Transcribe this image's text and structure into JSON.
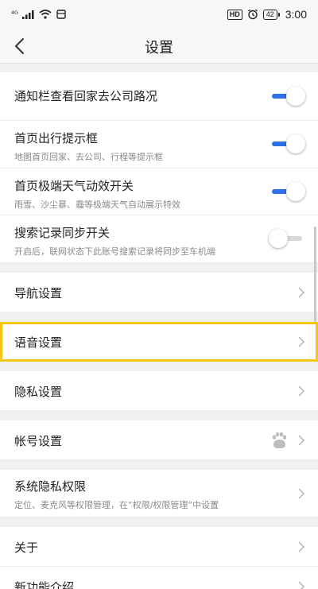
{
  "status_bar": {
    "signal_text": "⁴ᴳ",
    "hd": "HD",
    "battery": "42",
    "time": "3:00"
  },
  "header": {
    "title": "设置",
    "back_icon": "chevron-left-icon"
  },
  "settings": {
    "notif_route": {
      "label": "通知栏查看回家去公司路况",
      "toggle_state": "on"
    },
    "home_prompt": {
      "label": "首页出行提示框",
      "sub": "地图首页回家、去公司、行程等提示框",
      "toggle_state": "on"
    },
    "weather": {
      "label": "首页极端天气动效开关",
      "sub": "雨雪、沙尘暴、霾等极端天气自动展示特效",
      "toggle_state": "on"
    },
    "search_sync": {
      "label": "搜索记录同步开关",
      "sub": "开启后，联网状态下此账号搜索记录将同步至车机端",
      "toggle_state": "off"
    },
    "navigation": {
      "label": "导航设置"
    },
    "voice": {
      "label": "语音设置"
    },
    "privacy": {
      "label": "隐私设置"
    },
    "account": {
      "label": "帐号设置",
      "icon": "paw-icon"
    },
    "sys_privacy": {
      "label": "系统隐私权限",
      "sub": "定位、麦克风等权限管理，在“权限/权限管理”中设置"
    },
    "about": {
      "label": "关于"
    },
    "new_features": {
      "label": "新功能介绍"
    }
  },
  "colors": {
    "toggle_on": "#2f6fe8",
    "highlight": "#f5c518"
  }
}
